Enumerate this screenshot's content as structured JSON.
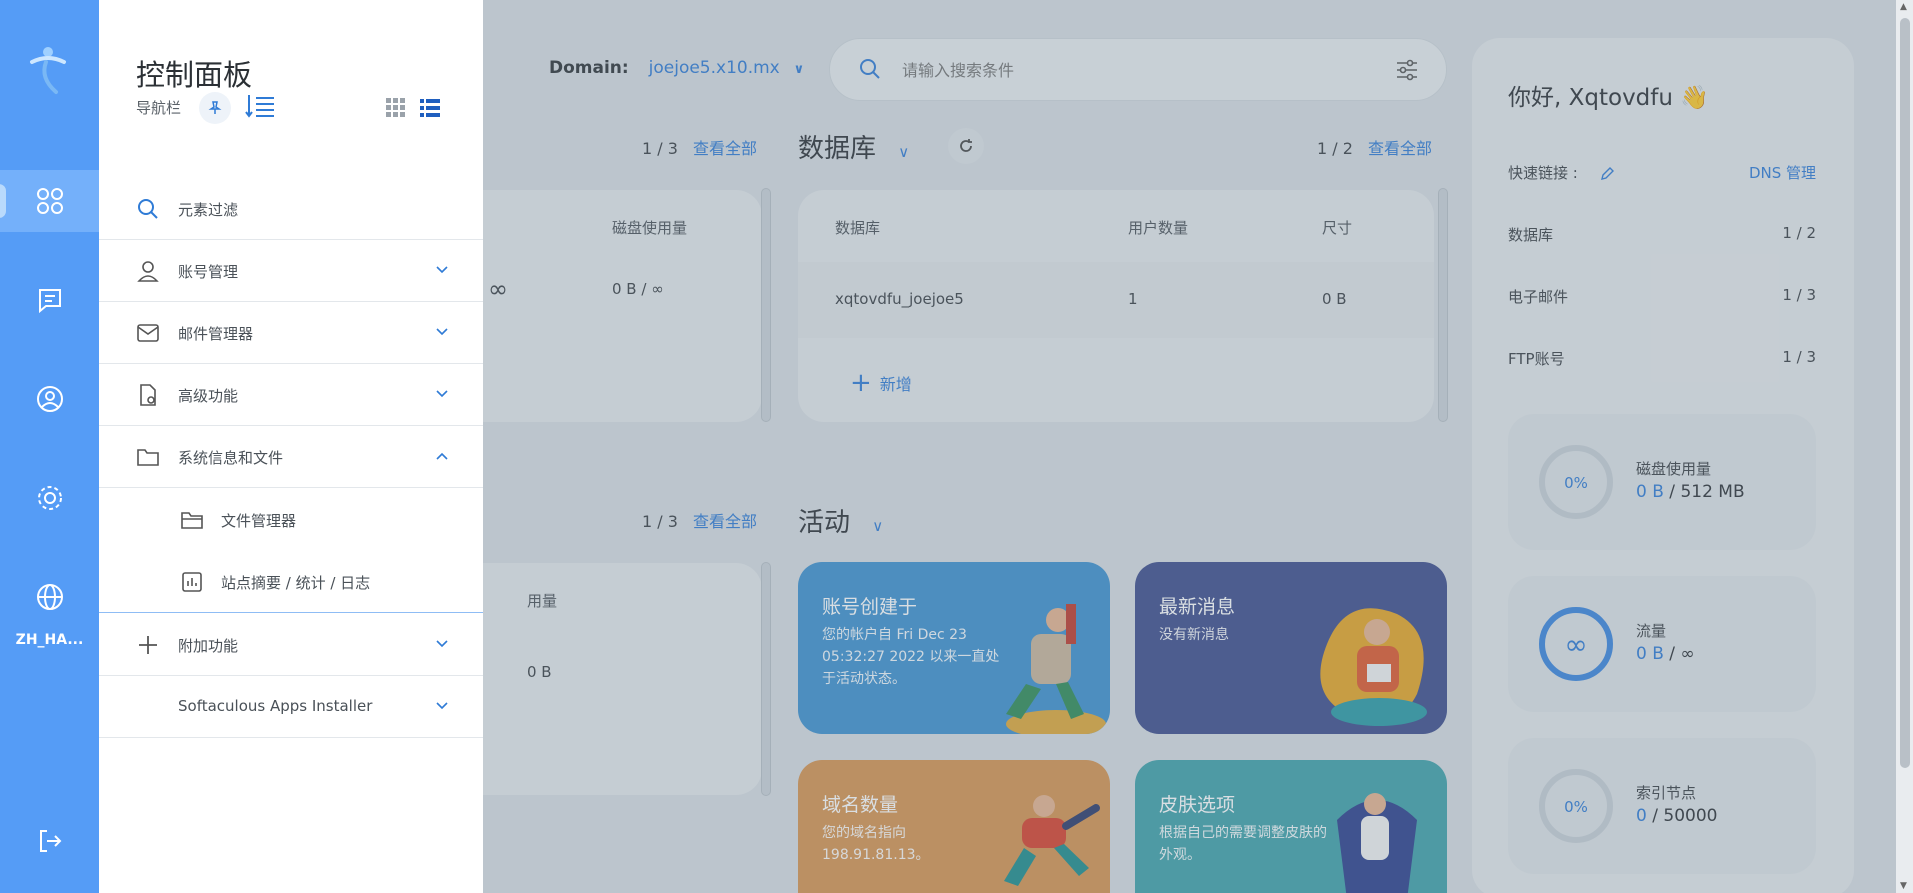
{
  "topbar": {
    "domain_label": "Domain:",
    "domain_value": "joejoe5.x10.mx",
    "search_placeholder": "请输入搜索条件"
  },
  "left_card": {
    "pager": "1 / 3",
    "view_all": "查看全部",
    "col_disk": "磁盘使用量",
    "row_quota": "∞",
    "row_disk": "0 B / ∞"
  },
  "database": {
    "title": "数据库",
    "pager": "1 / 2",
    "view_all": "查看全部",
    "columns": [
      "数据库",
      "用户数量",
      "尺寸"
    ],
    "rows": [
      {
        "name": "xqtovdfu_joejoe5",
        "users": "1",
        "size": "0 B"
      }
    ],
    "add_label": "新增"
  },
  "left_card2": {
    "pager": "1 / 3",
    "view_all": "查看全部",
    "col_usage": "用量",
    "row_usage": "0 B"
  },
  "activity": {
    "title": "活动",
    "tiles": [
      {
        "title": "账号创建于",
        "text": "您的帐户自 Fri Dec 23 05:32:27 2022 以来一直处于活动状态。",
        "color": "#3d91cf"
      },
      {
        "title": "最新消息",
        "text": "没有新消息",
        "color": "#3d4d8c"
      },
      {
        "title": "域名数量",
        "text": "您的域名指向 198.91.81.13。",
        "color": "#d6934f"
      },
      {
        "title": "皮肤选项",
        "text": "根据自己的需要调整皮肤的外观。",
        "color": "#3fa1aa"
      }
    ]
  },
  "right_panel": {
    "greeting": "你好, Xqtovdfu 👋",
    "quick_links_label": "快速链接 :",
    "dns_link": "DNS 管理",
    "rows": [
      {
        "label": "数据库",
        "value": "1 / 2"
      },
      {
        "label": "电子邮件",
        "value": "1 / 3"
      },
      {
        "label": "FTP账号",
        "value": "1 / 3"
      }
    ],
    "stats": [
      {
        "ring": "0%",
        "label": "磁盘使用量",
        "used": "0 B",
        "sep": " / ",
        "total": "512 MB"
      },
      {
        "ring": "∞",
        "label": "流量",
        "used": "0 B",
        "sep": " / ",
        "total": "∞"
      },
      {
        "ring": "0%",
        "label": "索引节点",
        "used": "0",
        "sep": " / ",
        "total": "50000"
      }
    ]
  },
  "rail": {
    "lang_label": "ZH_HA...",
    "colors": {
      "rail": "#559cf6",
      "active": "#74b0fa"
    }
  },
  "flyout": {
    "title": "控制面板",
    "subtitle": "导航栏",
    "items": [
      {
        "label": "元素过滤",
        "icon": "search-icon"
      },
      {
        "label": "账号管理",
        "icon": "user-icon"
      },
      {
        "label": "邮件管理器",
        "icon": "mail-icon"
      },
      {
        "label": "高级功能",
        "icon": "settings-doc-icon"
      },
      {
        "label": "系统信息和文件",
        "icon": "folder-icon"
      },
      {
        "label": "文件管理器",
        "icon": "folder-icon"
      },
      {
        "label": "站点摘要 / 统计 / 日志",
        "icon": "chart-icon"
      },
      {
        "label": "附加功能",
        "icon": "plus-icon"
      },
      {
        "label": "Softaculous Apps Installer",
        "icon": ""
      }
    ]
  }
}
